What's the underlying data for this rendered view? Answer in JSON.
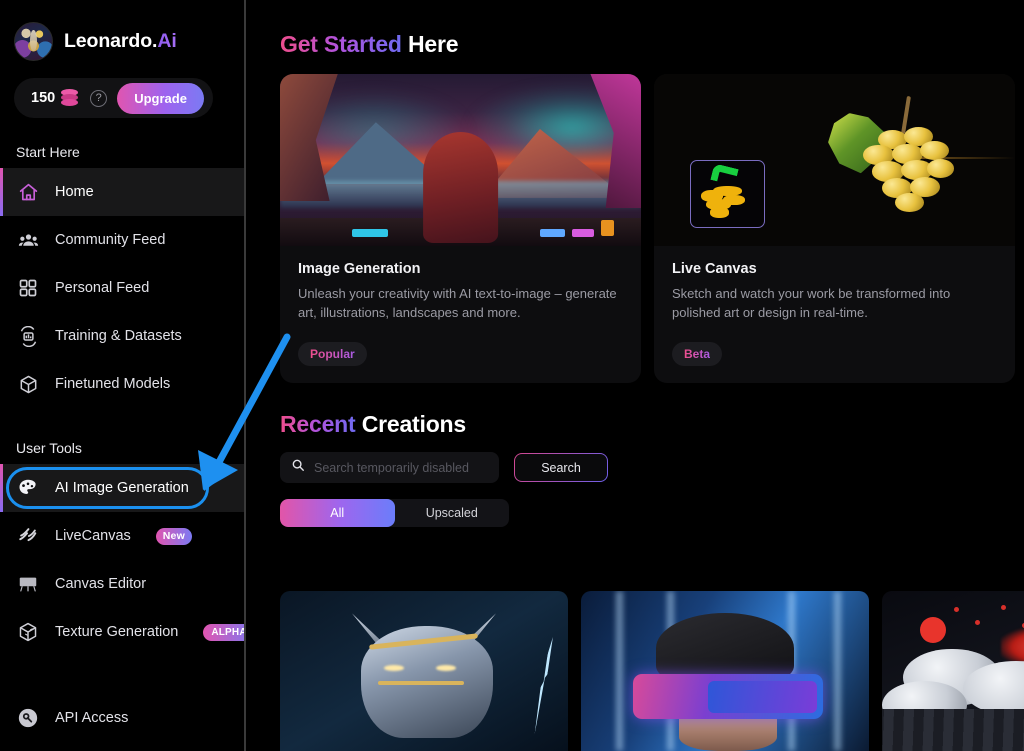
{
  "brand": {
    "name_main": "Leonardo.",
    "name_suffix": "Ai",
    "avatar_icon": "user-avatar"
  },
  "credits": {
    "amount": "150",
    "coin_icon": "coin-stack-icon",
    "help_icon": "help-circle-icon",
    "upgrade_label": "Upgrade"
  },
  "sidebar": {
    "sections": [
      {
        "label": "Start Here"
      },
      {
        "label": "User Tools"
      }
    ],
    "start_here_items": [
      {
        "label": "Home",
        "icon": "home-icon",
        "active": true
      },
      {
        "label": "Community Feed",
        "icon": "people-icon",
        "active": false
      },
      {
        "label": "Personal Feed",
        "icon": "grid-icon",
        "active": false
      },
      {
        "label": "Training & Datasets",
        "icon": "training-icon",
        "active": false
      },
      {
        "label": "Finetuned Models",
        "icon": "cube-icon",
        "active": false
      }
    ],
    "user_tools_items": [
      {
        "label": "AI Image Generation",
        "icon": "palette-icon",
        "badge": "",
        "highlighted": true
      },
      {
        "label": "LiveCanvas",
        "icon": "livecanvas-icon",
        "badge": "New",
        "highlighted": false
      },
      {
        "label": "Canvas Editor",
        "icon": "easel-icon",
        "badge": "",
        "highlighted": false
      },
      {
        "label": "Texture Generation",
        "icon": "texture-cube-icon",
        "badge": "ALPHA",
        "highlighted": false
      }
    ],
    "footer_items": [
      {
        "label": "API Access",
        "icon": "key-icon"
      }
    ]
  },
  "main": {
    "get_started": {
      "accent": "Get Started",
      "plain": "Here"
    },
    "cards": [
      {
        "title": "Image Generation",
        "description": "Unleash your creativity with AI text-to-image – generate art, illustrations, landscapes and more.",
        "pill": "Popular",
        "hero_icon": "fantasy-landscape-hero"
      },
      {
        "title": "Live Canvas",
        "description": "Sketch and watch your work be transformed into polished art or design in real-time.",
        "pill": "Beta",
        "hero_icon": "grapes-sketch-hero"
      }
    ],
    "recent": {
      "accent": "Recent",
      "plain": "Creations"
    },
    "search": {
      "icon": "search-icon",
      "value": "",
      "placeholder": "Search temporarily disabled",
      "button_label": "Search"
    },
    "tabs": [
      {
        "label": "All",
        "active": true
      },
      {
        "label": "Upscaled",
        "active": false
      }
    ],
    "thumbnails": [
      {
        "name": "armored-hero-lightning-thumbnail"
      },
      {
        "name": "cyberpunk-vr-portrait-thumbnail"
      },
      {
        "name": "red-clouds-samurai-thumbnail"
      }
    ]
  },
  "annotation": {
    "highlight_target": "AI Image Generation",
    "arrow_color": "#1e90f0",
    "ring_color": "#1b90ef"
  }
}
